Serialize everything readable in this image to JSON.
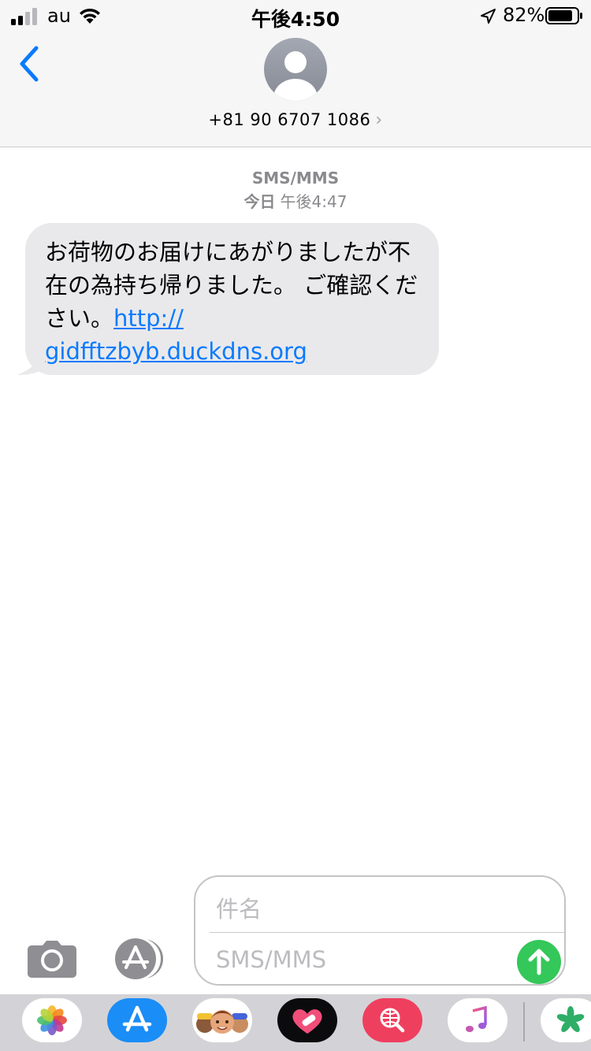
{
  "status_bar": {
    "carrier": "au",
    "time": "午後4:50",
    "battery": "82%"
  },
  "header": {
    "phone_number": "+81 90 6707 1086"
  },
  "conversation": {
    "service": "SMS/MMS",
    "date_label": "今日",
    "time_label": "午後4:47",
    "message_text": "お荷物のお届けにあがりましたが不在の為持ち帰りました。 ご確認ください。",
    "link_line1": "http://",
    "link_line2": "gidfftzbyb.duckdns.org"
  },
  "composer": {
    "subject_placeholder": "件名",
    "message_placeholder": "SMS/MMS"
  },
  "app_drawer": {
    "apps": [
      "photos-app",
      "app-store-app",
      "memoji-app",
      "heart-stickers-app",
      "web-search-app",
      "music-app",
      "clover-app"
    ]
  },
  "colors": {
    "accent": "#0a7aff",
    "bubble": "#e9e9eb",
    "send": "#34c759"
  }
}
